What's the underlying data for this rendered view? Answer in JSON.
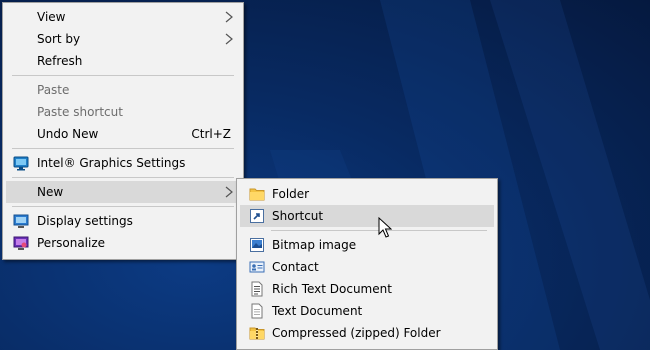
{
  "context_menu": {
    "items": [
      {
        "label": "View"
      },
      {
        "label": "Sort by"
      },
      {
        "label": "Refresh"
      },
      {
        "label": "Paste"
      },
      {
        "label": "Paste shortcut"
      },
      {
        "label": "Undo New",
        "shortcut": "Ctrl+Z"
      },
      {
        "label": "Intel® Graphics Settings",
        "icon": "intel-graphics-icon"
      },
      {
        "label": "New"
      },
      {
        "label": "Display settings",
        "icon": "display-icon"
      },
      {
        "label": "Personalize",
        "icon": "personalize-icon"
      }
    ]
  },
  "new_submenu": {
    "items": [
      {
        "label": "Folder",
        "icon": "folder-icon"
      },
      {
        "label": "Shortcut",
        "icon": "shortcut-icon"
      },
      {
        "label": "Bitmap image",
        "icon": "bitmap-icon"
      },
      {
        "label": "Contact",
        "icon": "contact-icon"
      },
      {
        "label": "Rich Text Document",
        "icon": "rich-text-document-icon"
      },
      {
        "label": "Text Document",
        "icon": "text-document-icon"
      },
      {
        "label": "Compressed (zipped) Folder",
        "icon": "zipped-folder-icon"
      }
    ]
  },
  "colors": {
    "menu_background": "#f2f2f2",
    "menu_highlight": "#d9d9d9",
    "disabled_text": "#6d6d6d",
    "desktop_background": "#0a2f6e"
  }
}
